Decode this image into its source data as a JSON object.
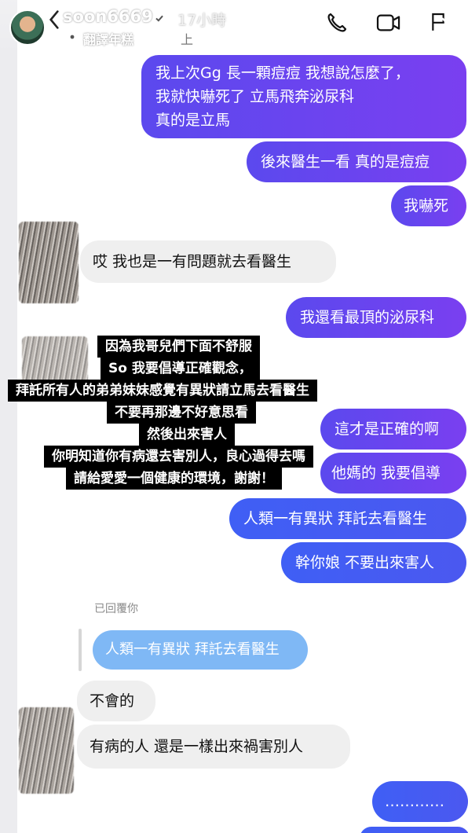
{
  "header": {
    "username": "soon6669",
    "time": "17小時",
    "music": "翻譯年糕",
    "music_suffix": "上"
  },
  "messages": {
    "m1": [
      "我上次Gg 長一顆痘痘 我想說怎麼了，",
      "我就快嚇死了 立馬飛奔泌尿科",
      "真的是立馬"
    ],
    "m2": "後來醫生一看 真的是痘痘",
    "m3": "我嚇死",
    "t1": "哎 我也是一有問題就去看醫生",
    "m4": "我還看最頂的泌尿科",
    "m5": "這才是正確的啊",
    "m6": "他媽的 我要倡導",
    "m7": "人類一有異狀 拜託去看醫生",
    "m8": "幹你娘 不要出來害人",
    "replied_label": "已回覆你",
    "quoted": "人類一有異狀 拜託去看醫生",
    "t2": "不會的",
    "t3": "有病的人 還是一樣出來禍害別人",
    "m9": "…………"
  },
  "caption": {
    "lines": [
      "因為我哥兒們下面不舒服",
      "So 我要倡導正確觀念，",
      "拜託所有人的弟弟妹妹感覺有異狀請立馬去看醫生",
      "不要再那邊不好意思看",
      "然後出來害人",
      "你明知道你有病還去害別人，良心過得去嗎",
      "請給愛愛一個健康的環境，謝謝！"
    ]
  },
  "icons": {
    "back": "chevron-left-icon",
    "verified": "verified-badge-icon",
    "music": "music-note-icon",
    "call": "phone-icon",
    "video": "video-camera-icon",
    "flag": "flag-icon",
    "close": "close-icon"
  },
  "colors": {
    "purple": "#6a43ef",
    "blue": "#4459f2",
    "quoted_bubble": "#7fb8f5",
    "incoming": "#efefef"
  }
}
